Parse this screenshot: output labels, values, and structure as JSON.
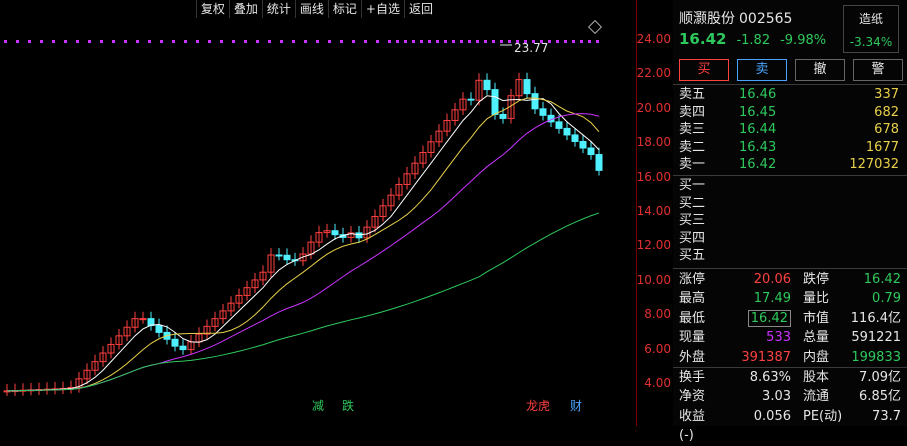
{
  "toolbar": [
    "复权",
    "叠加",
    "统计",
    "画线",
    "标记",
    "+自选",
    "返回"
  ],
  "price_axis": [
    "24.00",
    "22.00",
    "20.00",
    "18.00",
    "16.00",
    "14.00",
    "12.00",
    "10.00",
    "8.00",
    "6.00",
    "4.00"
  ],
  "high_annotation": "23.77",
  "markers": [
    {
      "text": "减",
      "color": "#2ec95c"
    },
    {
      "text": "跌",
      "color": "#2ec95c"
    },
    {
      "text": "龙虎",
      "color": "#ff4040"
    },
    {
      "text": "财",
      "color": "#4aa3ff"
    }
  ],
  "stock": {
    "name": "顺灏股份",
    "code": "002565",
    "price": "16.42",
    "change": "-1.82",
    "pct": "-9.98%"
  },
  "sector": {
    "name": "造纸",
    "pct": "-3.34%"
  },
  "trade_buttons": {
    "buy": "买",
    "sell": "卖",
    "cancel": "撤",
    "alert": "警"
  },
  "asks": [
    {
      "label": "卖五",
      "price": "16.46",
      "vol": "337"
    },
    {
      "label": "卖四",
      "price": "16.45",
      "vol": "682"
    },
    {
      "label": "卖三",
      "price": "16.44",
      "vol": "678"
    },
    {
      "label": "卖二",
      "price": "16.43",
      "vol": "1677"
    },
    {
      "label": "卖一",
      "price": "16.42",
      "vol": "127032"
    }
  ],
  "bids": [
    {
      "label": "买一",
      "price": "",
      "vol": ""
    },
    {
      "label": "买二",
      "price": "",
      "vol": ""
    },
    {
      "label": "买三",
      "price": "",
      "vol": ""
    },
    {
      "label": "买四",
      "price": "",
      "vol": ""
    },
    {
      "label": "买五",
      "price": "",
      "vol": ""
    }
  ],
  "stats": {
    "limit_up_label": "涨停",
    "limit_up": "20.06",
    "limit_down_label": "跌停",
    "limit_down": "16.42",
    "high_label": "最高",
    "high": "17.49",
    "vol_ratio_label": "量比",
    "vol_ratio": "0.79",
    "low_label": "最低",
    "low": "16.42",
    "mcap_label": "市值",
    "mcap": "116.4亿",
    "cur_vol_label": "现量",
    "cur_vol": "533",
    "total_vol_label": "总量",
    "total_vol": "591221",
    "outer_label": "外盘",
    "outer": "391387",
    "inner_label": "内盘",
    "inner": "199833",
    "turnover_label": "换手",
    "turnover": "8.63%",
    "shares_label": "股本",
    "shares": "7.09亿",
    "nav_label": "净资",
    "nav": "3.03",
    "float_label": "流通",
    "float": "6.85亿",
    "eps_label": "收益(-)",
    "eps": "0.056",
    "pe_label": "PE(动)",
    "pe": "73.7"
  },
  "colors": {
    "up": "#ff4040",
    "down": "#2ec95c",
    "flat": "#e6e6e6",
    "volume": "#e8d04a",
    "ma5": "#ffffff",
    "ma10": "#e8d04a",
    "ma20": "#cc33ff",
    "ma60": "#2ec95c"
  }
}
